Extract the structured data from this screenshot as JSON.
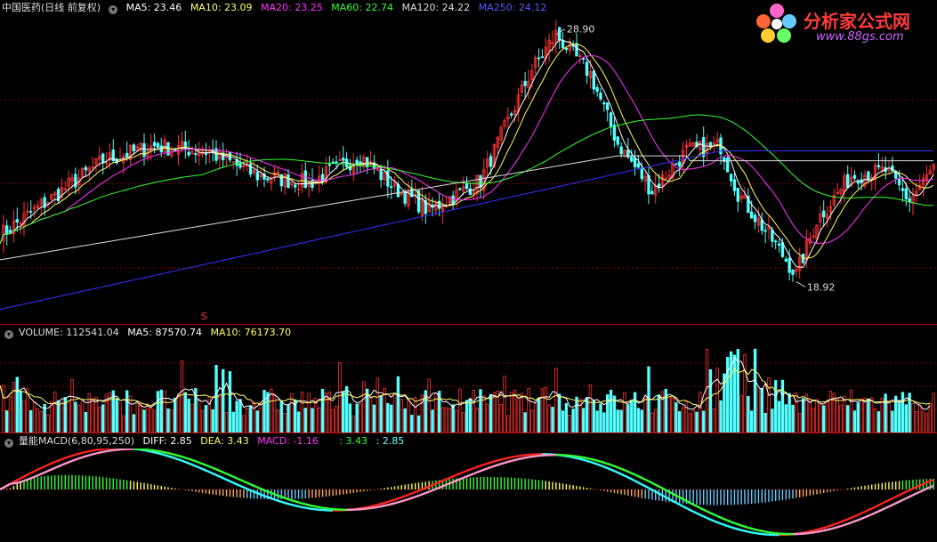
{
  "main_panel": {
    "title": "中国医药(日线 前复权)",
    "ma": [
      {
        "label": "MA5: 23.46",
        "color": "#ffffff"
      },
      {
        "label": "MA10: 23.09",
        "color": "#ffff66"
      },
      {
        "label": "MA20: 23.25",
        "color": "#ff33ff"
      },
      {
        "label": "MA60: 22.74",
        "color": "#33ff33"
      },
      {
        "label": "MA120: 24.22",
        "color": "#dddddd"
      },
      {
        "label": "MA250: 24.12",
        "color": "#4444ff"
      }
    ],
    "high_label": "28.90",
    "low_label": "18.92",
    "signal_mark": "S"
  },
  "volume_panel": {
    "label": "VOLUME: 112541.04",
    "ma5": "MA5: 87570.74",
    "ma10": "MA10: 76173.70"
  },
  "macd_panel": {
    "name": "量能MACD(6,80,95,250)",
    "diff": "DIFF: 2.85",
    "dea": "DEA: 3.43",
    "macd": "MACD: -1.16",
    "v1": ": 3.43",
    "v2": ": 2.85"
  },
  "logo": {
    "title": "分析家公式网",
    "url": "www.88gs.com"
  },
  "colors": {
    "up": "#ff3333",
    "down": "#54ffff",
    "grid": "#8b0000",
    "ma5": "#ffffff",
    "ma10": "#ffff66",
    "ma20": "#ff33ff",
    "ma60": "#33ff33",
    "ma120": "#dddddd",
    "ma250": "#3333ff"
  }
}
